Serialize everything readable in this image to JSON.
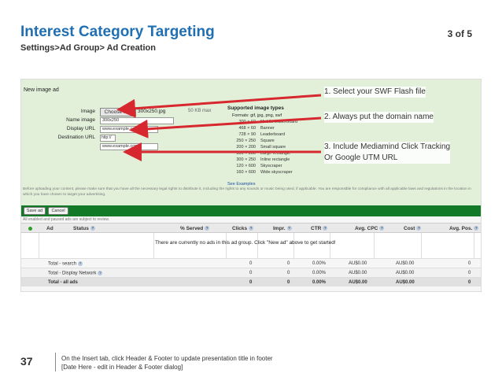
{
  "slide": {
    "title": "Interest Category Targeting",
    "page_count": "3 of 5",
    "breadcrumb": "Settings>Ad Group> Ad Creation",
    "number": "37",
    "footer_line1": "On the Insert tab, click Header & Footer to update presentation title in footer",
    "footer_line2": "[Date Here - edit in Header & Footer dialog]"
  },
  "form": {
    "panel_title": "New image ad",
    "image_label": "Image",
    "choose_file": "Choose File",
    "file_name": "300x250.jpg",
    "kb_max": "50 KB max",
    "name_label": "Name image",
    "name_value": "300x250",
    "display_url_label": "Display URL",
    "display_url_value": "www.example.com",
    "destination_label": "Destination URL",
    "protocol": "http://",
    "destination_value": "www.example.com"
  },
  "formats": {
    "title": "Supported image types",
    "formats_line": "Formats: gif, jpg, png, swf",
    "rows": [
      {
        "size": "300 × 60",
        "name": "Mobile leaderboard"
      },
      {
        "size": "468 × 60",
        "name": "Banner"
      },
      {
        "size": "728 × 90",
        "name": "Leaderboard"
      },
      {
        "size": "250 × 250",
        "name": "Square"
      },
      {
        "size": "200 × 200",
        "name": "Small square"
      },
      {
        "size": "336 × 280",
        "name": "Large rectangle"
      },
      {
        "size": "300 × 250",
        "name": "Inline rectangle"
      },
      {
        "size": "120 × 600",
        "name": "Skyscraper"
      },
      {
        "size": "160 × 600",
        "name": "Wide skyscraper"
      }
    ],
    "see_examples": "See Examples"
  },
  "instructions": {
    "step1": "1. Select your SWF Flash file",
    "step2": "2. Always put the domain name",
    "step3a": "3. Include Mediamind Click Tracking",
    "step3b": "Or Google UTM URL"
  },
  "disclaimer": "Before uploading your content, please make sure that you have all the necessary legal rights to distribute it, including the rights to any sounds or music being used, if applicable. You are responsible for compliance with all applicable laws and regulations in the location in which you have chosen to target your advertising.",
  "actions": {
    "save": "Save ad",
    "cancel": "Cancel",
    "all_enabled": "All enabled and paused ads are subject to review."
  },
  "table": {
    "headers": [
      "Ad",
      "Status",
      "% Served",
      "Clicks",
      "Impr.",
      "CTR",
      "Avg. CPC",
      "Cost",
      "Avg. Pos."
    ],
    "empty_message": "There are currently no ads in this ad group. Click \"New ad\" above to get started!",
    "totals": [
      {
        "label": "Total - search",
        "clicks": "0",
        "impr": "0",
        "ctr": "0.00%",
        "cpc": "AU$0.00",
        "cost": "AU$0.00",
        "pos": "0"
      },
      {
        "label": "Total - Display Network",
        "clicks": "0",
        "impr": "0",
        "ctr": "0.00%",
        "cpc": "AU$0.00",
        "cost": "AU$0.00",
        "pos": "0"
      },
      {
        "label": "Total - all ads",
        "clicks": "0",
        "impr": "0",
        "ctr": "0.00%",
        "cpc": "AU$0.00",
        "cost": "AU$0.00",
        "pos": "0"
      }
    ]
  },
  "colors": {
    "title": "#1f6fb2",
    "arrow": "#d8282f",
    "panel": "#e2f0da",
    "strip": "#127a27"
  }
}
